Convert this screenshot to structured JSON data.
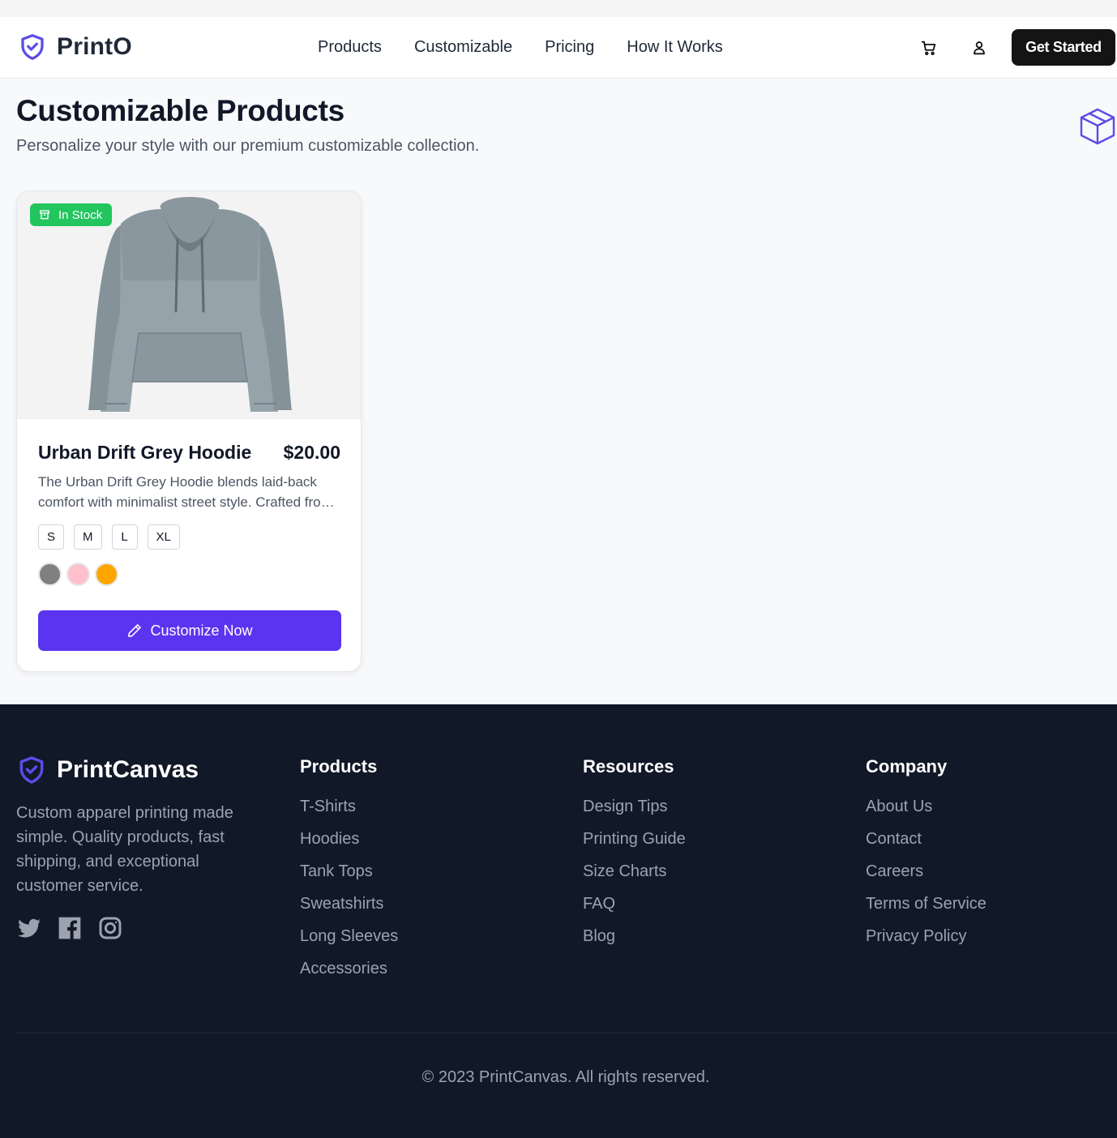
{
  "header": {
    "brand": "PrintO",
    "nav": [
      "Products",
      "Customizable",
      "Pricing",
      "How It Works"
    ],
    "cta": "Get Started"
  },
  "page": {
    "title": "Customizable Products",
    "subtitle": "Personalize your style with our premium customizable collection."
  },
  "product": {
    "badge": "In Stock",
    "name": "Urban Drift Grey Hoodie",
    "price": "$20.00",
    "description": "The Urban Drift Grey Hoodie blends laid-back comfort with minimalist street style. Crafted from premium materials for everyday wear.",
    "sizes": [
      "S",
      "M",
      "L",
      "XL"
    ],
    "colors": [
      "#808080",
      "#ffc0cb",
      "#ffa500"
    ],
    "button": "Customize Now"
  },
  "footer": {
    "brand": "PrintCanvas",
    "description": "Custom apparel printing made simple. Quality products, fast shipping, and exceptional customer service.",
    "columns": [
      {
        "title": "Products",
        "links": [
          "T-Shirts",
          "Hoodies",
          "Tank Tops",
          "Sweatshirts",
          "Long Sleeves",
          "Accessories"
        ]
      },
      {
        "title": "Resources",
        "links": [
          "Design Tips",
          "Printing Guide",
          "Size Charts",
          "FAQ",
          "Blog"
        ]
      },
      {
        "title": "Company",
        "links": [
          "About Us",
          "Contact",
          "Careers",
          "Terms of Service",
          "Privacy Policy"
        ]
      }
    ],
    "copyright": "© 2023 PrintCanvas. All rights reserved."
  },
  "colors": {
    "accent": "#5b34f0",
    "brand_icon": "#5b4ce8",
    "badge": "#22c55e",
    "footer_bg": "#111827"
  },
  "icons": [
    "shield-check-icon",
    "cart-icon",
    "user-icon",
    "box-icon",
    "archive-icon",
    "pencil-icon",
    "twitter-icon",
    "facebook-icon",
    "instagram-icon"
  ]
}
